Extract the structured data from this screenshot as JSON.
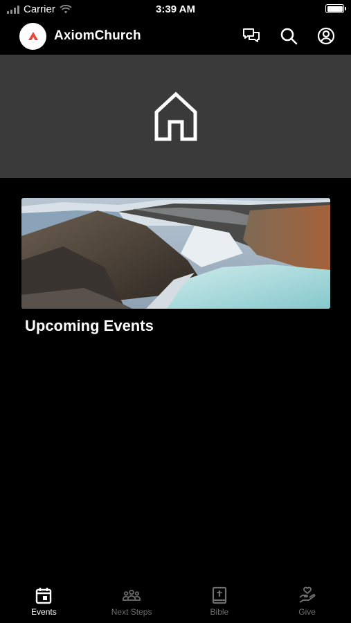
{
  "status_bar": {
    "carrier": "Carrier",
    "time": "3:39 AM"
  },
  "header": {
    "app_name": "AxiomChurch"
  },
  "hero": {
    "icon": "home-icon"
  },
  "events": {
    "section_title": "Upcoming Events"
  },
  "tabs": [
    {
      "label": "Events",
      "icon": "calendar-icon",
      "active": true
    },
    {
      "label": "Next Steps",
      "icon": "people-icon",
      "active": false
    },
    {
      "label": "Bible",
      "icon": "bible-icon",
      "active": false
    },
    {
      "label": "Give",
      "icon": "give-icon",
      "active": false
    }
  ],
  "colors": {
    "background": "#000000",
    "hero": "#3a3a3a",
    "brand": "#e8453c",
    "inactive_tab": "#6e6e6e"
  }
}
